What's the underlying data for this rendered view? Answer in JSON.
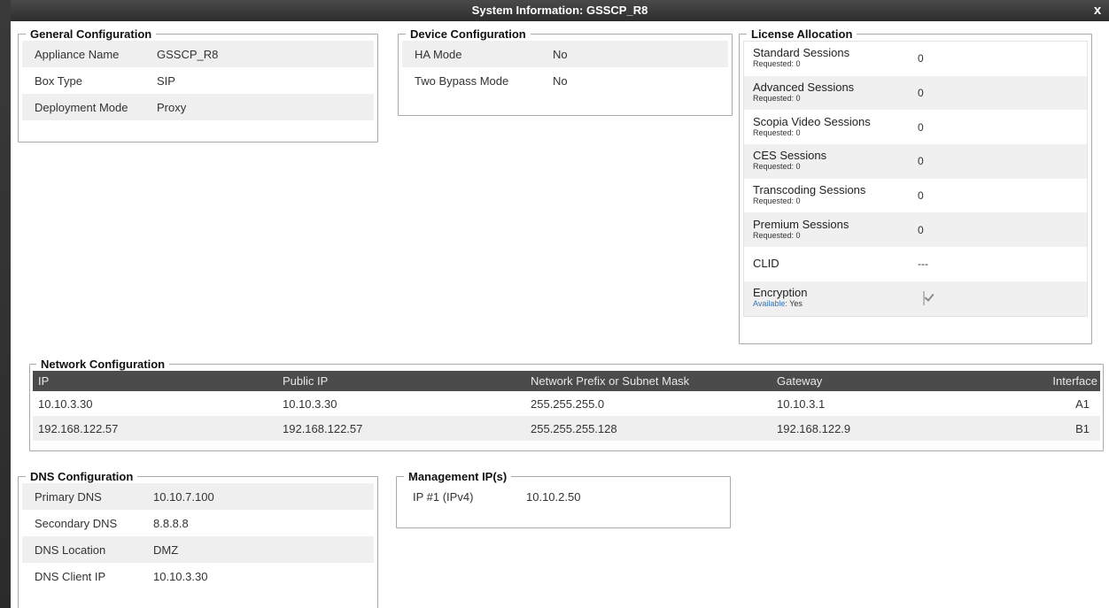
{
  "window": {
    "title": "System Information: GSSCP_R8",
    "close_label": "x"
  },
  "general": {
    "legend": "General Configuration",
    "rows": [
      {
        "key": "Appliance Name",
        "value": "GSSCP_R8"
      },
      {
        "key": "Box Type",
        "value": "SIP"
      },
      {
        "key": "Deployment Mode",
        "value": "Proxy"
      }
    ]
  },
  "device": {
    "legend": "Device Configuration",
    "rows": [
      {
        "key": "HA Mode",
        "value": "No"
      },
      {
        "key": "Two Bypass Mode",
        "value": "No"
      }
    ]
  },
  "license": {
    "legend": "License Allocation",
    "rows": [
      {
        "name": "Standard Sessions",
        "sub": "Requested: 0",
        "value": "0"
      },
      {
        "name": "Advanced Sessions",
        "sub": "Requested: 0",
        "value": "0"
      },
      {
        "name": "Scopia Video Sessions",
        "sub": "Requested: 0",
        "value": "0"
      },
      {
        "name": "CES Sessions",
        "sub": "Requested: 0",
        "value": "0"
      },
      {
        "name": "Transcoding Sessions",
        "sub": "Requested: 0",
        "value": "0"
      },
      {
        "name": "Premium Sessions",
        "sub": "Requested: 0",
        "value": "0"
      },
      {
        "name": "CLID",
        "sub": "",
        "value": "---"
      }
    ],
    "encryption": {
      "name": "Encryption",
      "sub_label": "Available:",
      "sub_value": "Yes",
      "checked": true
    }
  },
  "network": {
    "legend": "Network Configuration",
    "headers": [
      "IP",
      "Public IP",
      "Network Prefix or Subnet Mask",
      "Gateway",
      "Interface"
    ],
    "rows": [
      [
        "10.10.3.30",
        "10.10.3.30",
        "255.255.255.0",
        "10.10.3.1",
        "A1"
      ],
      [
        "192.168.122.57",
        "192.168.122.57",
        "255.255.255.128",
        "192.168.122.9",
        "B1"
      ]
    ]
  },
  "dns": {
    "legend": "DNS Configuration",
    "rows": [
      {
        "key": "Primary DNS",
        "value": "10.10.7.100"
      },
      {
        "key": "Secondary DNS",
        "value": "8.8.8.8"
      },
      {
        "key": "DNS Location",
        "value": "DMZ"
      },
      {
        "key": "DNS Client IP",
        "value": "10.10.3.30"
      }
    ]
  },
  "management": {
    "legend": "Management IP(s)",
    "rows": [
      {
        "key": "IP #1 (IPv4)",
        "value": "10.10.2.50"
      }
    ]
  }
}
